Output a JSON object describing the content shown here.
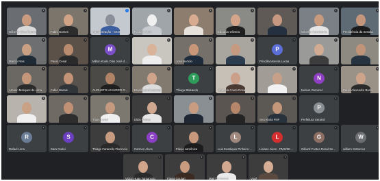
{
  "meeting": {
    "bar_color": "#202124",
    "avatar_tile_color": "#3c4043",
    "mic_muted_icon": "mic-off-icon",
    "mic_active_icon": "mic-speaking-icon"
  },
  "rows": [
    [
      {
        "name": "Gilberto Silva Ramos",
        "kind": "video",
        "bg": "#6a6e72",
        "skin": "#c99b80",
        "shirt": "#d9d9d9",
        "muted": true
      },
      {
        "name": "Fabio Gomes",
        "kind": "video",
        "bg": "#7b756c",
        "skin": "#d1a386",
        "shirt": "#2c2c2c",
        "muted": true
      },
      {
        "name": "Administração - SEO",
        "kind": "video",
        "bg": "#c4c8cf",
        "skin": "#8a8f99",
        "shirt": "#3b5fa0",
        "muted": false,
        "speaking": true
      },
      {
        "name": "Rodrigo Stein",
        "kind": "video",
        "bg": "#9fa5a9",
        "skin": "#f0f0f0",
        "shirt": "#c7cbd0",
        "muted": true
      },
      {
        "name": "",
        "kind": "video",
        "bg": "#8c7d6e",
        "skin": "#d6ab8f",
        "shirt": "#e8e2dc",
        "muted": true
      },
      {
        "name": "Eduardo Oliveira",
        "kind": "video",
        "bg": "#8a8a86",
        "skin": "#d4a58a",
        "shirt": "#1f1f1f",
        "muted": true
      },
      {
        "name": "",
        "kind": "video",
        "bg": "#5f5a55",
        "skin": "#c69882",
        "shirt": "#243040",
        "muted": true
      },
      {
        "name": "Gilberto Cavalcante",
        "kind": "video",
        "bg": "#7a8086",
        "skin": "#c79a7e",
        "shirt": "#e5e5e5",
        "muted": true
      },
      {
        "name": "Presidência da Sessão",
        "kind": "video",
        "bg": "#5e6b74",
        "skin": "#c4977c",
        "shirt": "#1b1b1b",
        "muted": true
      }
    ],
    [
      {
        "name": "Marcio Reis",
        "kind": "video",
        "bg": "#6d6f70",
        "skin": "#c9a083",
        "shirt": "#1e2a36",
        "muted": true
      },
      {
        "name": "Paulo Cesar",
        "kind": "video",
        "bg": "#5b5149",
        "skin": "#b98b6f",
        "shirt": "#2a2a2a",
        "muted": true
      },
      {
        "name": "Milton Kools Dias José de...",
        "kind": "avatar",
        "initial": "M",
        "color": "#7b4fc7",
        "muted": true
      },
      {
        "name": "",
        "kind": "video",
        "bg": "#c9c6bf",
        "skin": "#d9b29a",
        "shirt": "#eeeeee",
        "muted": true
      },
      {
        "name": "José Bertolo",
        "kind": "video",
        "bg": "#76706a",
        "skin": "#c89779",
        "shirt": "#1d2b3a",
        "muted": true
      },
      {
        "name": "",
        "kind": "video",
        "bg": "#a8a69f",
        "skin": "#c59a80",
        "shirt": "#2d3d50",
        "muted": true
      },
      {
        "name": "Priscilla Moreira Lucas",
        "kind": "avatar",
        "initial": "P",
        "color": "#5b6fd6",
        "muted": true
      },
      {
        "name": "",
        "kind": "video",
        "bg": "#9a9b98",
        "skin": "#d1ab92",
        "shirt": "#3d3d3d",
        "muted": true
      },
      {
        "name": "",
        "kind": "video",
        "bg": "#8e8a82",
        "skin": "#bf9478",
        "shirt": "#263340",
        "muted": true
      }
    ],
    [
      {
        "name": "Amauri Marques de Lima",
        "kind": "video",
        "bg": "#6b6762",
        "skin": "#c4967a",
        "shirt": "#2b2b2b",
        "muted": true
      },
      {
        "name": "Fabio Morais",
        "kind": "video",
        "bg": "#58524c",
        "skin": "#c39377",
        "shirt": "#30353a",
        "muted": true
      },
      {
        "name": "AUGUSTO LEANDRO DE OLI...",
        "kind": "video",
        "bg": "#4c4a47",
        "skin": "#b08266",
        "shirt": "#1f1f1f",
        "muted": true
      },
      {
        "name": "Brasília professional",
        "kind": "video",
        "bg": "#82796f",
        "skin": "#cfa48a",
        "shirt": "#dcdcdc",
        "muted": true
      },
      {
        "name": "Thiago Balsando",
        "kind": "avatar",
        "initial": "T",
        "color": "#2e9b5b",
        "muted": true
      },
      {
        "name": "Gabriela Couto Rosa",
        "kind": "video",
        "bg": "#c7c0b6",
        "skin": "#caa08a",
        "shirt": "#4a3a34",
        "muted": true
      },
      {
        "name": "",
        "kind": "video",
        "bg": "#a19d96",
        "skin": "#c7a089",
        "shirt": "#f2f2f2",
        "muted": true
      },
      {
        "name": "Nelson Gemmel",
        "kind": "avatar",
        "initial": "N",
        "color": "#8f3fc2",
        "muted": true
      },
      {
        "name": "Paulo Alexandre Bucci",
        "kind": "video",
        "bg": "#9a9187",
        "skin": "#cda489",
        "shirt": "#2b2b2b",
        "muted": true
      }
    ],
    [
      {
        "name": "",
        "kind": "video",
        "bg": "#b8b4ad",
        "skin": "#c9a185",
        "shirt": "#f0f0f0",
        "muted": true
      },
      {
        "name": "",
        "kind": "video",
        "bg": "#6f6a63",
        "skin": "#c09174",
        "shirt": "#2e2e2e",
        "muted": true
      },
      {
        "name": "Thais Lovari",
        "kind": "video",
        "bg": "#7c776f",
        "skin": "#c59a7f",
        "shirt": "#efefef",
        "muted": true
      },
      {
        "name": "Didio França",
        "kind": "video",
        "bg": "#3d3d3d",
        "skin": "#d0a88f",
        "shirt": "#e6e6e6",
        "muted": true
      },
      {
        "name": "",
        "kind": "video",
        "bg": "#8a8f93",
        "skin": "#c89c80",
        "shirt": "#1e2733",
        "muted": true
      },
      {
        "name": "",
        "kind": "video",
        "bg": "#5a5550",
        "skin": "#b6876b",
        "shirt": "#242424",
        "muted": true
      },
      {
        "name": "Secretaria FNP",
        "kind": "video",
        "bg": "#5c5853",
        "skin": "#c4977b",
        "shirt": "#28323c",
        "muted": true
      },
      {
        "name": "Prefeitura Seramil",
        "kind": "avatar",
        "initial": "P",
        "color": "#8a8f94",
        "muted": true
      }
    ],
    [
      {
        "name": "Rafael Lima",
        "kind": "avatar",
        "initial": "R",
        "color": "#6b7d96",
        "muted": true
      },
      {
        "name": "Sara Godoi",
        "kind": "avatar",
        "initial": "S",
        "color": "#6a3fc0",
        "muted": true
      },
      {
        "name": "Thiago Faranello Florencio",
        "kind": "video",
        "bg": "#3d3d3d",
        "skin": "#c89c80",
        "shirt": "#2a2a2a",
        "muted": true
      },
      {
        "name": "Carmen Alves",
        "kind": "avatar",
        "initial": "C",
        "color": "#8b3fc5",
        "muted": true
      },
      {
        "name": "Flávio Lamônica",
        "kind": "video",
        "bg": "#3d3d3d",
        "skin": "#c7987c",
        "shirt": "#1c1c1c",
        "muted": true
      },
      {
        "name": "Luis Eustáquio Pinheiro B...",
        "kind": "avatar",
        "initial": "L",
        "color": "#a1887f",
        "muted": true
      },
      {
        "name": "Lisiane Alves - PMS/SEM...",
        "kind": "avatar",
        "initial": "L",
        "color": "#d32f2f",
        "muted": true
      },
      {
        "name": "Gilliard Fontes Rosal Secr...",
        "kind": "avatar",
        "initial": "G",
        "color": "#8d6e63",
        "muted": true
      },
      {
        "name": "william Sottorriva",
        "kind": "avatar",
        "initial": "W",
        "color": "#6d6f73",
        "muted": true
      }
    ],
    [
      {
        "name": "Victor Hugo Yamamoto",
        "kind": "video",
        "bg": "#3d3d3d",
        "skin": "#d0a58a",
        "shirt": "#2a2a2a",
        "muted": true
      },
      {
        "name": "Flavia Goulart",
        "kind": "video",
        "bg": "#3d3d3d",
        "skin": "#c99b7f",
        "shirt": "#3a2a22",
        "muted": true
      },
      {
        "name": "Mari Di possosi",
        "kind": "video",
        "bg": "#3d3d3d",
        "skin": "#d2a890",
        "shirt": "#eaeaea",
        "muted": true
      },
      {
        "name": "Você",
        "kind": "video",
        "bg": "#3d3d3d",
        "skin": "#d4ad94",
        "shirt": "#5a4a40",
        "muted": true
      }
    ]
  ]
}
